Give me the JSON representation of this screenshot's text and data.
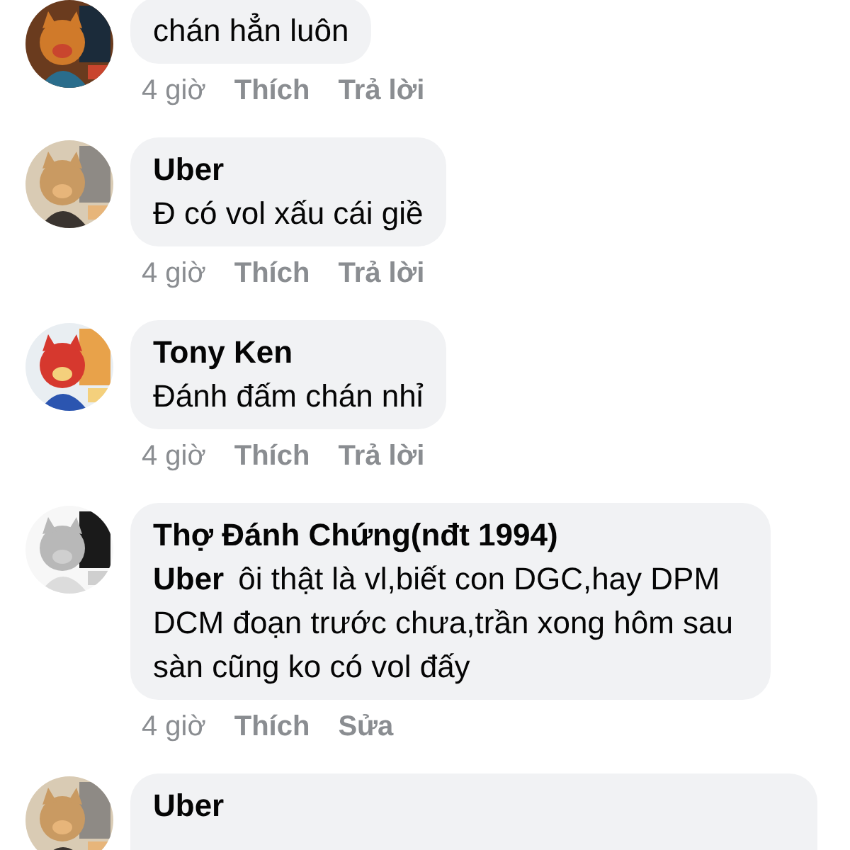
{
  "comments": [
    {
      "text": "chán hẳn luôn",
      "time": "4 giờ",
      "actions": [
        "Thích",
        "Trả lời"
      ]
    },
    {
      "author": "Uber",
      "text": "Đ có vol xấu cái giề",
      "time": "4 giờ",
      "actions": [
        "Thích",
        "Trả lời"
      ]
    },
    {
      "author": "Tony Ken",
      "text": "Đánh đấm chán nhỉ",
      "time": "4 giờ",
      "actions": [
        "Thích",
        "Trả lời"
      ]
    },
    {
      "author": "Thợ Đánh Chứng(nđt 1994)",
      "mention": "Uber",
      "text": "ôi thật là vl,biết con DGC,hay DPM DCM đoạn trước chưa,trần xong hôm sau sàn cũng ko có vol đấy",
      "time": "4 giờ",
      "actions": [
        "Thích",
        "Sửa"
      ]
    },
    {
      "author": "Uber"
    }
  ]
}
